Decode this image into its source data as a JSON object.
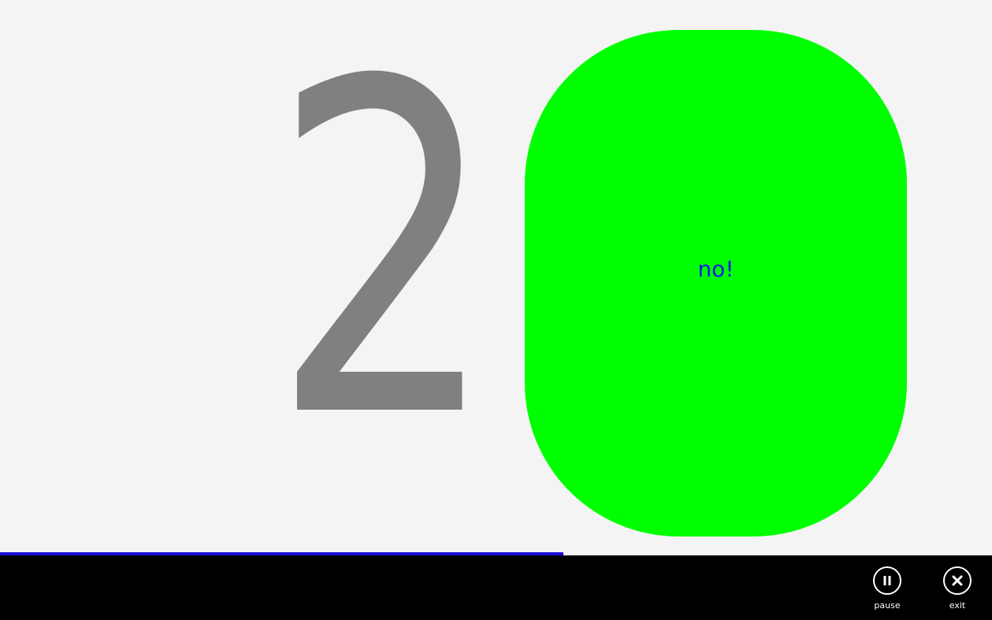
{
  "game": {
    "countdown_number": "2",
    "target_label": "no!",
    "progress_fraction": 0.568
  },
  "appbar": {
    "pause_label": "pause",
    "exit_label": "exit"
  },
  "colors": {
    "stage_background": "#f4f4f4",
    "number_color": "#808080",
    "target_fill": "#00ff00",
    "target_text": "#0a1be0",
    "progress_fill": "#1a0ed8",
    "appbar_background": "#000000",
    "appbar_foreground": "#ffffff"
  },
  "icons": {
    "pause": "pause-icon",
    "exit": "close-icon"
  }
}
